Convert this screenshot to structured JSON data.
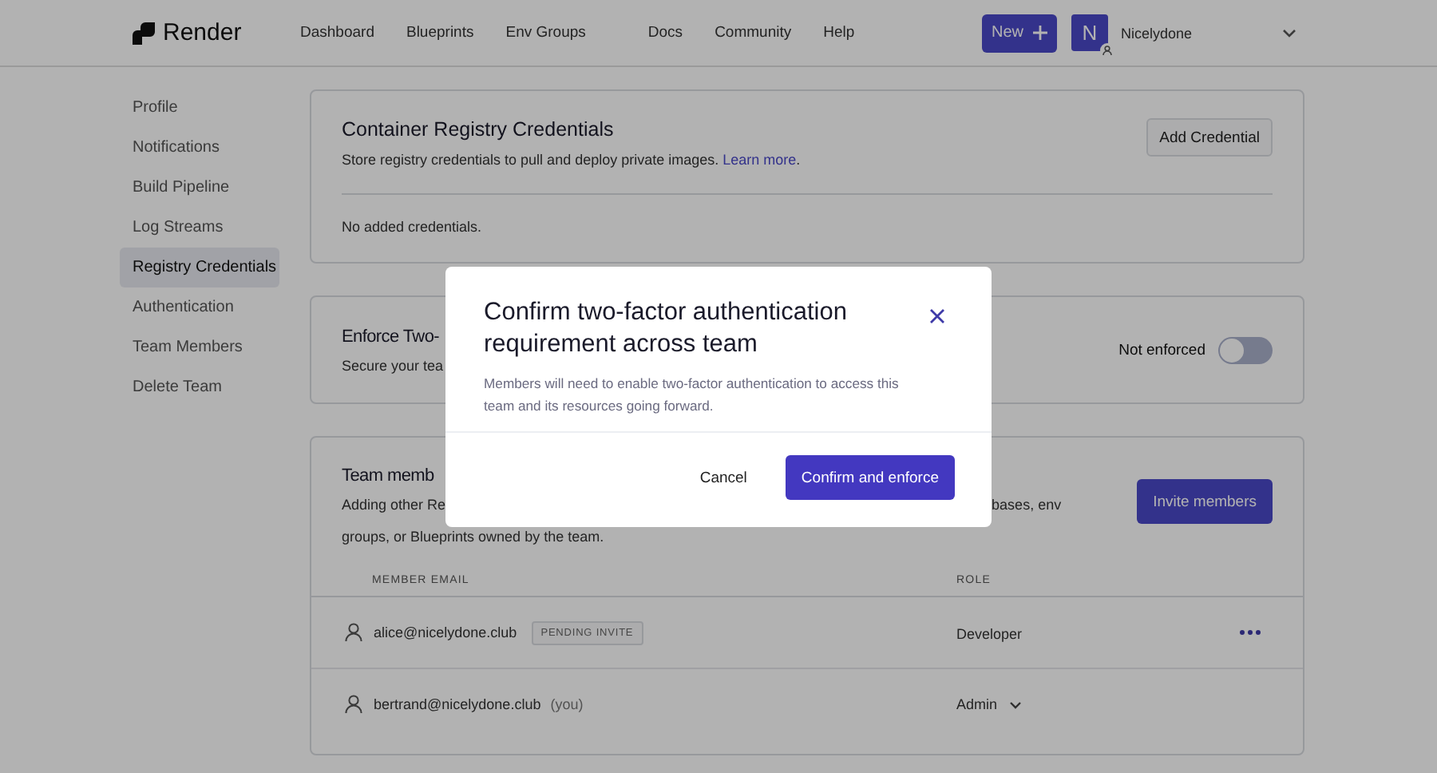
{
  "header": {
    "logo": "Render",
    "nav": [
      "Dashboard",
      "Blueprints",
      "Env Groups"
    ],
    "nav_secondary": [
      "Docs",
      "Community",
      "Help"
    ],
    "new_button": "New",
    "avatar_letter": "N",
    "account": "Nicelydone"
  },
  "sidebar": {
    "items": [
      {
        "label": "Profile",
        "selected": false
      },
      {
        "label": "Notifications",
        "selected": false
      },
      {
        "label": "Build Pipeline",
        "selected": false
      },
      {
        "label": "Log Streams",
        "selected": false
      },
      {
        "label": "Registry Credentials",
        "selected": true
      },
      {
        "label": "Authentication",
        "selected": false
      },
      {
        "label": "Team Members",
        "selected": false
      },
      {
        "label": "Delete Team",
        "selected": false
      }
    ]
  },
  "registry": {
    "title": "Container Registry Credentials",
    "description": "Store registry credentials to pull and deploy private images.",
    "link": "Learn more",
    "description_end": ".",
    "button": "Add Credential",
    "empty": "No added credentials."
  },
  "enforce": {
    "title": "Enforce Two-",
    "description": "Secure your tea",
    "status": "Not enforced",
    "on": false
  },
  "members": {
    "title": "Team memb",
    "description_left": "Adding other Re",
    "description_right": "bases, env",
    "description_line2": "groups, or Blueprints owned by the team.",
    "button": "Invite members",
    "columns": [
      "MEMBER EMAIL",
      "ROLE"
    ],
    "rows": [
      {
        "email": "alice@nicelydone.club",
        "badge": "PENDING INVITE",
        "note": "",
        "role": "Developer",
        "role_dropdown": false,
        "actions": true
      },
      {
        "email": "bertrand@nicelydone.club",
        "badge": "",
        "note": "(you)",
        "role": "Admin",
        "role_dropdown": true,
        "actions": false
      }
    ]
  },
  "modal": {
    "title": "Confirm two-factor authentication requirement across team",
    "body": "Members will need to enable two-factor authentication to access this team and its resources going forward.",
    "cancel": "Cancel",
    "confirm": "Confirm and enforce"
  }
}
